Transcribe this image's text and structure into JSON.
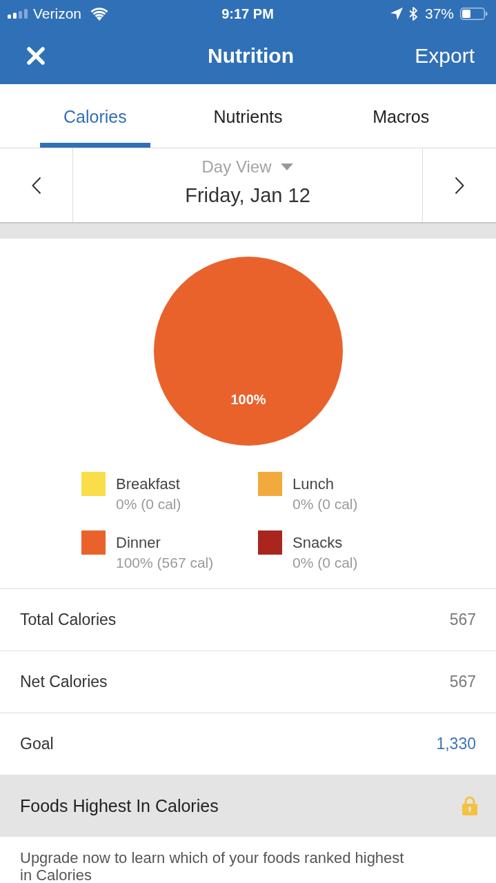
{
  "status_bar": {
    "carrier": "Verizon",
    "time": "9:17 PM",
    "battery": "37%"
  },
  "nav_bar": {
    "title": "Nutrition",
    "action": "Export"
  },
  "tabs": [
    {
      "label": "Calories",
      "selected": true
    },
    {
      "label": "Nutrients",
      "selected": false
    },
    {
      "label": "Macros",
      "selected": false
    }
  ],
  "date_nav": {
    "view": "Day View",
    "date": "Friday, Jan 12"
  },
  "chart": {
    "chart_data": {
      "type": "pie",
      "categories": [
        "Breakfast",
        "Lunch",
        "Dinner",
        "Snacks"
      ],
      "values": [
        0,
        0,
        100,
        0
      ],
      "value_labels": [
        null,
        null,
        "100%",
        null
      ]
    },
    "legend": [
      {
        "color": "#f9de4a",
        "detail": "0% (0 cal)"
      },
      {
        "color": "#f2aa3c",
        "detail": "0% (0 cal)"
      },
      {
        "color": "#e9622c",
        "detail": "100% (567 cal)"
      },
      {
        "color": "#a9261d",
        "detail": "0% (0 cal)"
      }
    ]
  },
  "summary": [
    {
      "label": "Total Calories",
      "value": "567",
      "kind": "plain"
    },
    {
      "label": "Net Calories",
      "value": "567",
      "kind": "plain"
    },
    {
      "label": "Goal",
      "value": "1,330",
      "kind": "link"
    }
  ],
  "foods_section": {
    "title": "Foods Highest In Calories",
    "locked": true,
    "message": "Upgrade now to learn which of your foods ranked highest in Calories"
  }
}
